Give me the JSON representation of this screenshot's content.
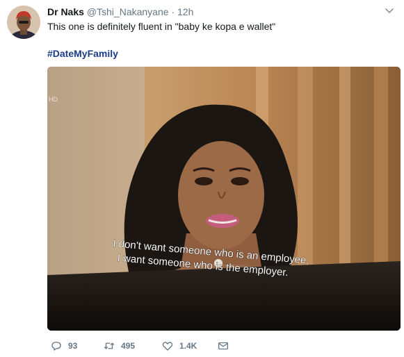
{
  "tweet": {
    "author_name": "Dr Naks",
    "author_handle": "@Tshi_Nakanyane",
    "separator": "·",
    "time": "12h",
    "text": "This one is definitely fluent in \"baby ke kopa e wallet\"",
    "hashtag": "#DateMyFamily"
  },
  "media": {
    "watermark": "HD",
    "subtitle_line1": "I don't want someone who is an employee,",
    "subtitle_line2": "I want someone who is the employer."
  },
  "actions": {
    "replies": "93",
    "retweets": "495",
    "likes": "1.4K"
  },
  "colors": {
    "text": "#14171a",
    "secondary": "#657786",
    "hashtag": "#1b3c8a"
  }
}
